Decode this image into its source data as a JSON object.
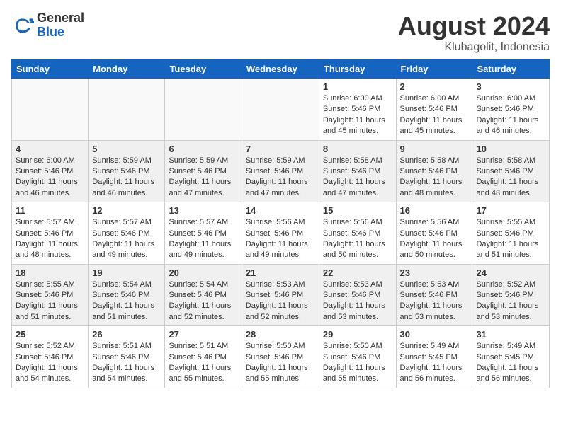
{
  "header": {
    "logo_general": "General",
    "logo_blue": "Blue",
    "title": "August 2024",
    "location": "Klubagolit, Indonesia"
  },
  "days_of_week": [
    "Sunday",
    "Monday",
    "Tuesday",
    "Wednesday",
    "Thursday",
    "Friday",
    "Saturday"
  ],
  "weeks": [
    {
      "shaded": false,
      "days": [
        {
          "num": "",
          "info": ""
        },
        {
          "num": "",
          "info": ""
        },
        {
          "num": "",
          "info": ""
        },
        {
          "num": "",
          "info": ""
        },
        {
          "num": "1",
          "info": "Sunrise: 6:00 AM\nSunset: 5:46 PM\nDaylight: 11 hours\nand 45 minutes."
        },
        {
          "num": "2",
          "info": "Sunrise: 6:00 AM\nSunset: 5:46 PM\nDaylight: 11 hours\nand 45 minutes."
        },
        {
          "num": "3",
          "info": "Sunrise: 6:00 AM\nSunset: 5:46 PM\nDaylight: 11 hours\nand 46 minutes."
        }
      ]
    },
    {
      "shaded": true,
      "days": [
        {
          "num": "4",
          "info": "Sunrise: 6:00 AM\nSunset: 5:46 PM\nDaylight: 11 hours\nand 46 minutes."
        },
        {
          "num": "5",
          "info": "Sunrise: 5:59 AM\nSunset: 5:46 PM\nDaylight: 11 hours\nand 46 minutes."
        },
        {
          "num": "6",
          "info": "Sunrise: 5:59 AM\nSunset: 5:46 PM\nDaylight: 11 hours\nand 47 minutes."
        },
        {
          "num": "7",
          "info": "Sunrise: 5:59 AM\nSunset: 5:46 PM\nDaylight: 11 hours\nand 47 minutes."
        },
        {
          "num": "8",
          "info": "Sunrise: 5:58 AM\nSunset: 5:46 PM\nDaylight: 11 hours\nand 47 minutes."
        },
        {
          "num": "9",
          "info": "Sunrise: 5:58 AM\nSunset: 5:46 PM\nDaylight: 11 hours\nand 48 minutes."
        },
        {
          "num": "10",
          "info": "Sunrise: 5:58 AM\nSunset: 5:46 PM\nDaylight: 11 hours\nand 48 minutes."
        }
      ]
    },
    {
      "shaded": false,
      "days": [
        {
          "num": "11",
          "info": "Sunrise: 5:57 AM\nSunset: 5:46 PM\nDaylight: 11 hours\nand 48 minutes."
        },
        {
          "num": "12",
          "info": "Sunrise: 5:57 AM\nSunset: 5:46 PM\nDaylight: 11 hours\nand 49 minutes."
        },
        {
          "num": "13",
          "info": "Sunrise: 5:57 AM\nSunset: 5:46 PM\nDaylight: 11 hours\nand 49 minutes."
        },
        {
          "num": "14",
          "info": "Sunrise: 5:56 AM\nSunset: 5:46 PM\nDaylight: 11 hours\nand 49 minutes."
        },
        {
          "num": "15",
          "info": "Sunrise: 5:56 AM\nSunset: 5:46 PM\nDaylight: 11 hours\nand 50 minutes."
        },
        {
          "num": "16",
          "info": "Sunrise: 5:56 AM\nSunset: 5:46 PM\nDaylight: 11 hours\nand 50 minutes."
        },
        {
          "num": "17",
          "info": "Sunrise: 5:55 AM\nSunset: 5:46 PM\nDaylight: 11 hours\nand 51 minutes."
        }
      ]
    },
    {
      "shaded": true,
      "days": [
        {
          "num": "18",
          "info": "Sunrise: 5:55 AM\nSunset: 5:46 PM\nDaylight: 11 hours\nand 51 minutes."
        },
        {
          "num": "19",
          "info": "Sunrise: 5:54 AM\nSunset: 5:46 PM\nDaylight: 11 hours\nand 51 minutes."
        },
        {
          "num": "20",
          "info": "Sunrise: 5:54 AM\nSunset: 5:46 PM\nDaylight: 11 hours\nand 52 minutes."
        },
        {
          "num": "21",
          "info": "Sunrise: 5:53 AM\nSunset: 5:46 PM\nDaylight: 11 hours\nand 52 minutes."
        },
        {
          "num": "22",
          "info": "Sunrise: 5:53 AM\nSunset: 5:46 PM\nDaylight: 11 hours\nand 53 minutes."
        },
        {
          "num": "23",
          "info": "Sunrise: 5:53 AM\nSunset: 5:46 PM\nDaylight: 11 hours\nand 53 minutes."
        },
        {
          "num": "24",
          "info": "Sunrise: 5:52 AM\nSunset: 5:46 PM\nDaylight: 11 hours\nand 53 minutes."
        }
      ]
    },
    {
      "shaded": false,
      "days": [
        {
          "num": "25",
          "info": "Sunrise: 5:52 AM\nSunset: 5:46 PM\nDaylight: 11 hours\nand 54 minutes."
        },
        {
          "num": "26",
          "info": "Sunrise: 5:51 AM\nSunset: 5:46 PM\nDaylight: 11 hours\nand 54 minutes."
        },
        {
          "num": "27",
          "info": "Sunrise: 5:51 AM\nSunset: 5:46 PM\nDaylight: 11 hours\nand 55 minutes."
        },
        {
          "num": "28",
          "info": "Sunrise: 5:50 AM\nSunset: 5:46 PM\nDaylight: 11 hours\nand 55 minutes."
        },
        {
          "num": "29",
          "info": "Sunrise: 5:50 AM\nSunset: 5:46 PM\nDaylight: 11 hours\nand 55 minutes."
        },
        {
          "num": "30",
          "info": "Sunrise: 5:49 AM\nSunset: 5:45 PM\nDaylight: 11 hours\nand 56 minutes."
        },
        {
          "num": "31",
          "info": "Sunrise: 5:49 AM\nSunset: 5:45 PM\nDaylight: 11 hours\nand 56 minutes."
        }
      ]
    }
  ]
}
